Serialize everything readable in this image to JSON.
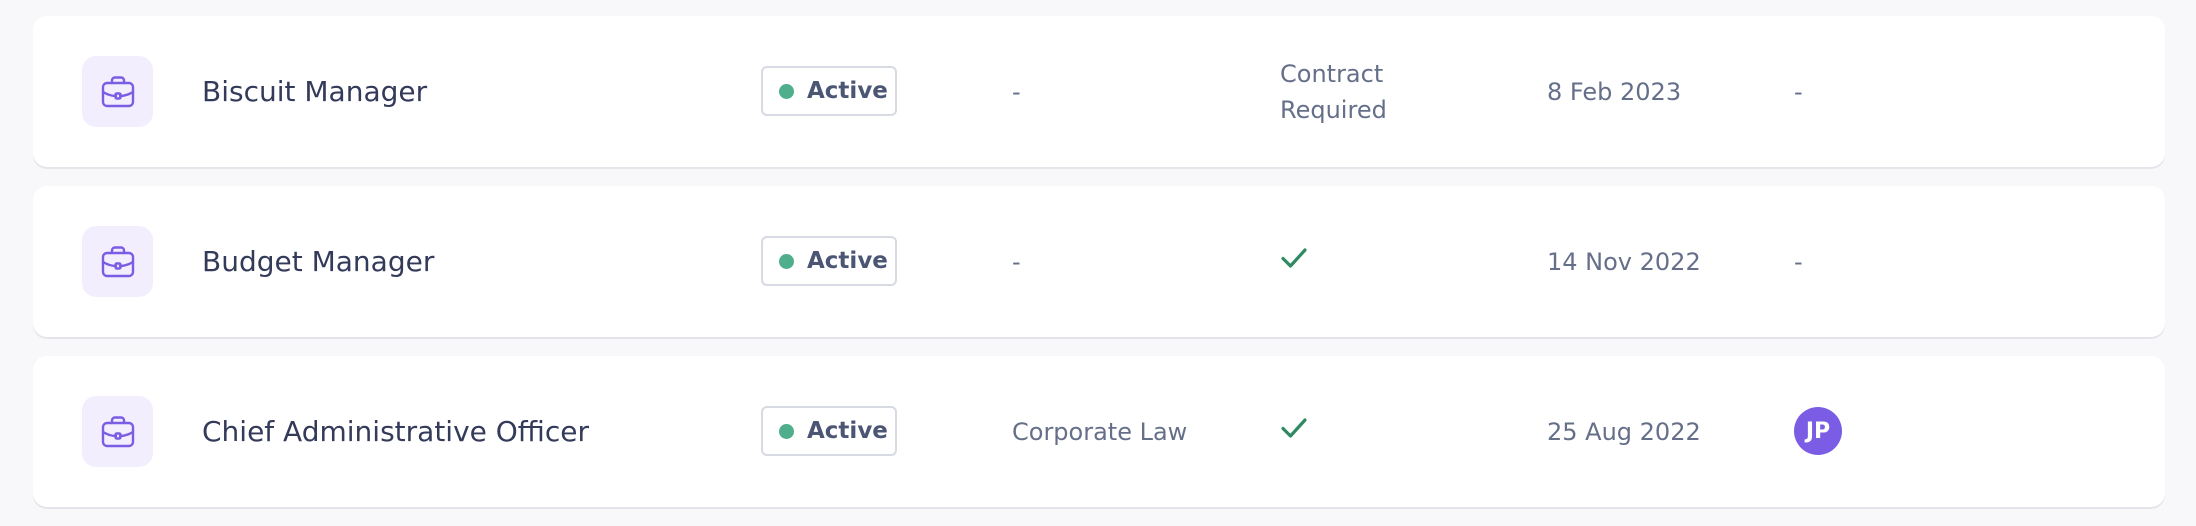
{
  "roles": [
    {
      "icon": "briefcase-icon",
      "title": "Biscuit Manager",
      "status": "Active",
      "department": "-",
      "contract": "Contract Required",
      "contract_ok": false,
      "date": "8 Feb 2023",
      "owner": "-",
      "owner_initials": ""
    },
    {
      "icon": "briefcase-icon",
      "title": "Budget Manager",
      "status": "Active",
      "department": "-",
      "contract": "",
      "contract_ok": true,
      "date": "14 Nov 2022",
      "owner": "-",
      "owner_initials": ""
    },
    {
      "icon": "briefcase-icon",
      "title": "Chief Administrative Officer",
      "status": "Active",
      "department": "Corporate Law",
      "contract": "",
      "contract_ok": true,
      "date": "25 Aug 2022",
      "owner": "",
      "owner_initials": "JP"
    }
  ],
  "colors": {
    "accent": "#7b5ce5",
    "status_active": "#4fae8c",
    "check": "#2f8a64",
    "icon_tile_bg": "#f2eefd"
  }
}
